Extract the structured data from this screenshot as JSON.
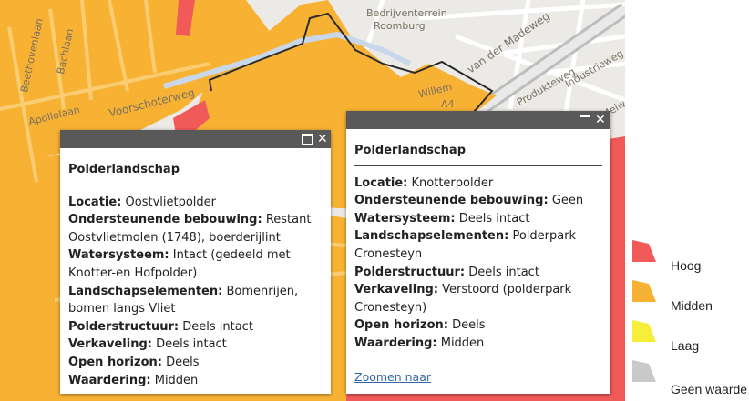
{
  "map": {
    "labels": [
      "Bedrijventerrein",
      "Roomburg",
      "Voorschoterweg",
      "Beethovenlaan",
      "Bachlaan",
      "Apollolaan",
      "Produkteweg",
      "Industrieweg",
      "Vijf Meiweg",
      "Willem",
      "van der Madeweg",
      "A4"
    ],
    "colors": {
      "hoog": "#f25a5a",
      "midden": "#f7b233",
      "laag": "#f5ef3a",
      "geen": "#c9c9c9",
      "boundary": "#2b2b2b"
    }
  },
  "popup1": {
    "title": "Polderlandschap",
    "rows": [
      {
        "k": "Locatie:",
        "v": " Oostvlietpolder"
      },
      {
        "k": "Ondersteunende bebouwing:",
        "v": " Restant Oostvlietmolen (1748), boerderijlint"
      },
      {
        "k": "Watersysteem:",
        "v": " Intact (gedeeld met Knotter-en Hofpolder)"
      },
      {
        "k": "Landschapselementen:",
        "v": " Bomenrijen, bomen langs Vliet"
      },
      {
        "k": "Polderstructuur:",
        "v": " Deels intact"
      },
      {
        "k": "Verkaveling:",
        "v": " Deels intact"
      },
      {
        "k": "Open horizon:",
        "v": " Deels"
      },
      {
        "k": "Waardering:",
        "v": " Midden"
      }
    ]
  },
  "popup2": {
    "title": "Polderlandschap",
    "rows": [
      {
        "k": "Locatie:",
        "v": " Knotterpolder"
      },
      {
        "k": "Ondersteunende bebouwing:",
        "v": " Geen"
      },
      {
        "k": "Watersysteem:",
        "v": " Deels intact"
      },
      {
        "k": "Landschapselementen:",
        "v": " Polderpark Cronesteyn"
      },
      {
        "k": "Polderstructuur:",
        "v": " Deels intact"
      },
      {
        "k": "Verkaveling:",
        "v": " Verstoord (polderpark Cronesteyn)"
      },
      {
        "k": "Open horizon:",
        "v": " Deels"
      },
      {
        "k": "Waardering:",
        "v": " Midden"
      }
    ],
    "link": "Zoomen naar"
  },
  "buttons": {
    "maximize": "maximize",
    "close": "✕"
  },
  "legend": {
    "items": [
      {
        "label": "Hoog",
        "color": "#f25a5a"
      },
      {
        "label": "Midden",
        "color": "#f7b233"
      },
      {
        "label": "Laag",
        "color": "#f5ef3a"
      },
      {
        "label": "Geen waarde",
        "color": "#c9c9c9"
      }
    ]
  }
}
